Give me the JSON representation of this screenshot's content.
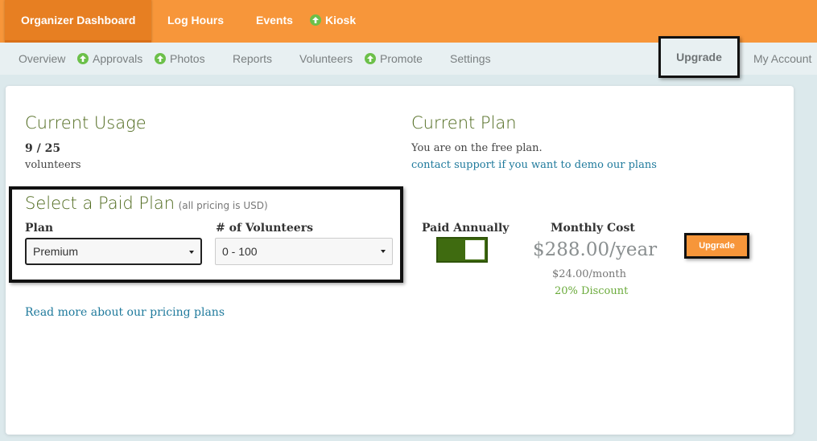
{
  "topnav": {
    "items": [
      {
        "label": "Organizer Dashboard"
      },
      {
        "label": "Log Hours"
      },
      {
        "label": "Events"
      },
      {
        "label": "Kiosk"
      }
    ]
  },
  "subnav": {
    "items": [
      {
        "label": "Overview"
      },
      {
        "label": "Approvals"
      },
      {
        "label": "Photos"
      },
      {
        "label": "Reports"
      },
      {
        "label": "Volunteers"
      },
      {
        "label": "Promote"
      },
      {
        "label": "Settings"
      },
      {
        "label": "Upgrade"
      },
      {
        "label": "My Account"
      }
    ]
  },
  "usage": {
    "title": "Current Usage",
    "count": "9 / 25",
    "unit": "volunteers"
  },
  "current_plan": {
    "title": "Current Plan",
    "status": "You are on the free plan.",
    "support_link": "contact support if you want to demo our plans"
  },
  "select_plan": {
    "title": "Select a Paid Plan",
    "note": "(all pricing is USD)",
    "plan_label": "Plan",
    "plan_value": "Premium",
    "volunteers_label": "# of Volunteers",
    "volunteers_value": "0 - 100"
  },
  "billing": {
    "paid_annually_label": "Paid Annually",
    "paid_annually_on": true,
    "monthly_cost_label": "Monthly Cost",
    "price": "$288.00/year",
    "per_month": "$24.00/month",
    "discount": "20% Discount",
    "upgrade_button": "Upgrade"
  },
  "pricing_link": "Read more about our pricing plans",
  "colors": {
    "brand_orange": "#f7963a",
    "heading_green": "#4f6a1e",
    "toggle_green": "#3f6b10",
    "discount_green": "#6aaa3a",
    "link_blue": "#1f7a9c"
  }
}
